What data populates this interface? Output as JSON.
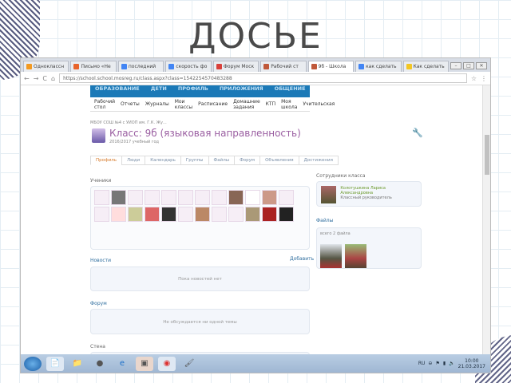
{
  "slide_title": "ДОСЬЕ",
  "browser": {
    "tabs": [
      {
        "label": "Одноклассн",
        "color": "#f39a21"
      },
      {
        "label": "Письмо «Не",
        "color": "#e8632a"
      },
      {
        "label": "последний",
        "color": "#4285f4"
      },
      {
        "label": "скорость фо",
        "color": "#4285f4"
      },
      {
        "label": "Форум Моск",
        "color": "#d9403a"
      },
      {
        "label": "Рабочий ст",
        "color": "#c0593a"
      },
      {
        "label": "9б - Школа",
        "color": "#c0593a",
        "active": true
      },
      {
        "label": "как сделать",
        "color": "#4285f4"
      },
      {
        "label": "Как сделать",
        "color": "#f3c623"
      }
    ],
    "url": "https://school.school.mosreg.ru/class.aspx?class=1542254570483288"
  },
  "site": {
    "nav": [
      "ОБРАЗОВАНИЕ",
      "ДЕТИ",
      "ПРОФИЛЬ",
      "ПРИЛОЖЕНИЯ",
      "ОБЩЕНИЕ"
    ],
    "subnav": [
      "Рабочий стол",
      "Отчеты",
      "Журналы",
      "Мои классы",
      "Расписание",
      "Домашние задания",
      "КТП",
      "Моя школа",
      "Учительская"
    ],
    "breadcrumb": "МБОУ СОШ №4 с УИОП им. Г.К. Жу...",
    "class_title": "Класс: 9б (языковая направленность)",
    "class_subtitle": "2016/2017 учебный год",
    "tabs": [
      "Профиль",
      "Люди",
      "Календарь",
      "Группы",
      "Файлы",
      "Форум",
      "Объявления",
      "Достижения"
    ],
    "students_label": "Ученики",
    "news_label": "Новости",
    "news_add": "Добавить",
    "news_empty": "Пока новостей нет",
    "forum_label": "Форум",
    "forum_empty": "Не обсуждается ни одной темы",
    "wall_label": "Стена",
    "staff_label": "Сотрудники класса",
    "teacher_name": "Колотушкина Лариса Александровна",
    "teacher_role": "Классный руководитель",
    "files_label": "Файлы",
    "files_count": "всего 2 файла"
  },
  "taskbar": {
    "time": "10:00",
    "date": "21.03.2017",
    "lang": "RU"
  }
}
